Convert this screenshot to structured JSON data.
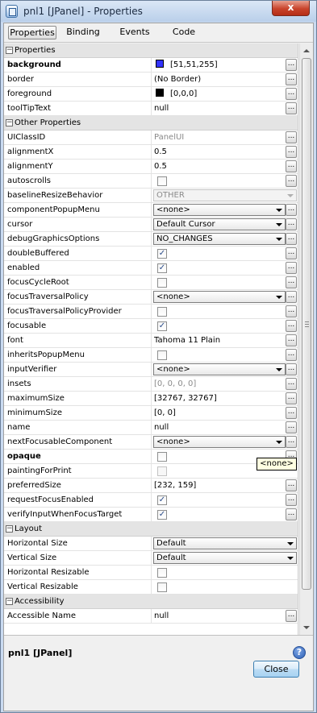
{
  "window": {
    "title": "pnl1 [JPanel] - Properties",
    "close_glyph": "x"
  },
  "tabs": [
    "Properties",
    "Binding",
    "Events",
    "Code"
  ],
  "sections": {
    "properties": {
      "toggle": "−",
      "label": "Properties"
    },
    "other": {
      "toggle": "−",
      "label": "Other Properties"
    },
    "layout": {
      "toggle": "−",
      "label": "Layout"
    },
    "accessibility": {
      "toggle": "−",
      "label": "Accessibility"
    }
  },
  "rows": {
    "background": {
      "name": "background",
      "value": "[51,51,255]",
      "color": "#3333ff"
    },
    "border": {
      "name": "border",
      "value": "(No Border)"
    },
    "foreground": {
      "name": "foreground",
      "value": "[0,0,0]",
      "color": "#000000"
    },
    "toolTipText": {
      "name": "toolTipText",
      "value": "null"
    },
    "UIClassID": {
      "name": "UIClassID",
      "value": "PanelUI"
    },
    "alignmentX": {
      "name": "alignmentX",
      "value": "0.5"
    },
    "alignmentY": {
      "name": "alignmentY",
      "value": "0.5"
    },
    "autoscrolls": {
      "name": "autoscrolls",
      "checked": false
    },
    "baselineResizeBehavior": {
      "name": "baselineResizeBehavior",
      "value": "OTHER"
    },
    "componentPopupMenu": {
      "name": "componentPopupMenu",
      "value": "<none>"
    },
    "cursor": {
      "name": "cursor",
      "value": "Default Cursor"
    },
    "debugGraphicsOptions": {
      "name": "debugGraphicsOptions",
      "value": "NO_CHANGES"
    },
    "doubleBuffered": {
      "name": "doubleBuffered",
      "checked": true
    },
    "enabled": {
      "name": "enabled",
      "checked": true
    },
    "focusCycleRoot": {
      "name": "focusCycleRoot",
      "checked": false
    },
    "focusTraversalPolicy": {
      "name": "focusTraversalPolicy",
      "value": "<none>"
    },
    "focusTraversalPolicyProvider": {
      "name": "focusTraversalPolicyProvider",
      "checked": false
    },
    "focusable": {
      "name": "focusable",
      "checked": true
    },
    "font": {
      "name": "font",
      "value": "Tahoma 11 Plain"
    },
    "inheritsPopupMenu": {
      "name": "inheritsPopupMenu",
      "checked": false
    },
    "inputVerifier": {
      "name": "inputVerifier",
      "value": "<none>"
    },
    "insets": {
      "name": "insets",
      "value": "[0, 0, 0, 0]"
    },
    "maximumSize": {
      "name": "maximumSize",
      "value": "[32767, 32767]"
    },
    "minimumSize": {
      "name": "minimumSize",
      "value": "[0, 0]"
    },
    "name": {
      "name": "name",
      "value": "null"
    },
    "nextFocusableComponent": {
      "name": "nextFocusableComponent",
      "value": "<none>"
    },
    "opaque": {
      "name": "opaque",
      "checked": false
    },
    "paintingForPrint": {
      "name": "paintingForPrint",
      "checked": false
    },
    "preferredSize": {
      "name": "preferredSize",
      "value": "[232, 159]"
    },
    "requestFocusEnabled": {
      "name": "requestFocusEnabled",
      "checked": true
    },
    "verifyInputWhenFocusTarget": {
      "name": "verifyInputWhenFocusTarget",
      "checked": true
    },
    "horizontalSize": {
      "name": "Horizontal Size",
      "value": "Default"
    },
    "verticalSize": {
      "name": "Vertical Size",
      "value": "Default"
    },
    "horizontalResizable": {
      "name": "Horizontal Resizable",
      "checked": false
    },
    "verticalResizable": {
      "name": "Vertical Resizable",
      "checked": false
    },
    "accessibleName": {
      "name": "Accessible Name",
      "value": "null"
    }
  },
  "check_mark": "✓",
  "ellipsis": "...",
  "tooltip": "<none>",
  "description": {
    "title": "pnl1 [JPanel]",
    "help_glyph": "?"
  },
  "close_button": "Close"
}
